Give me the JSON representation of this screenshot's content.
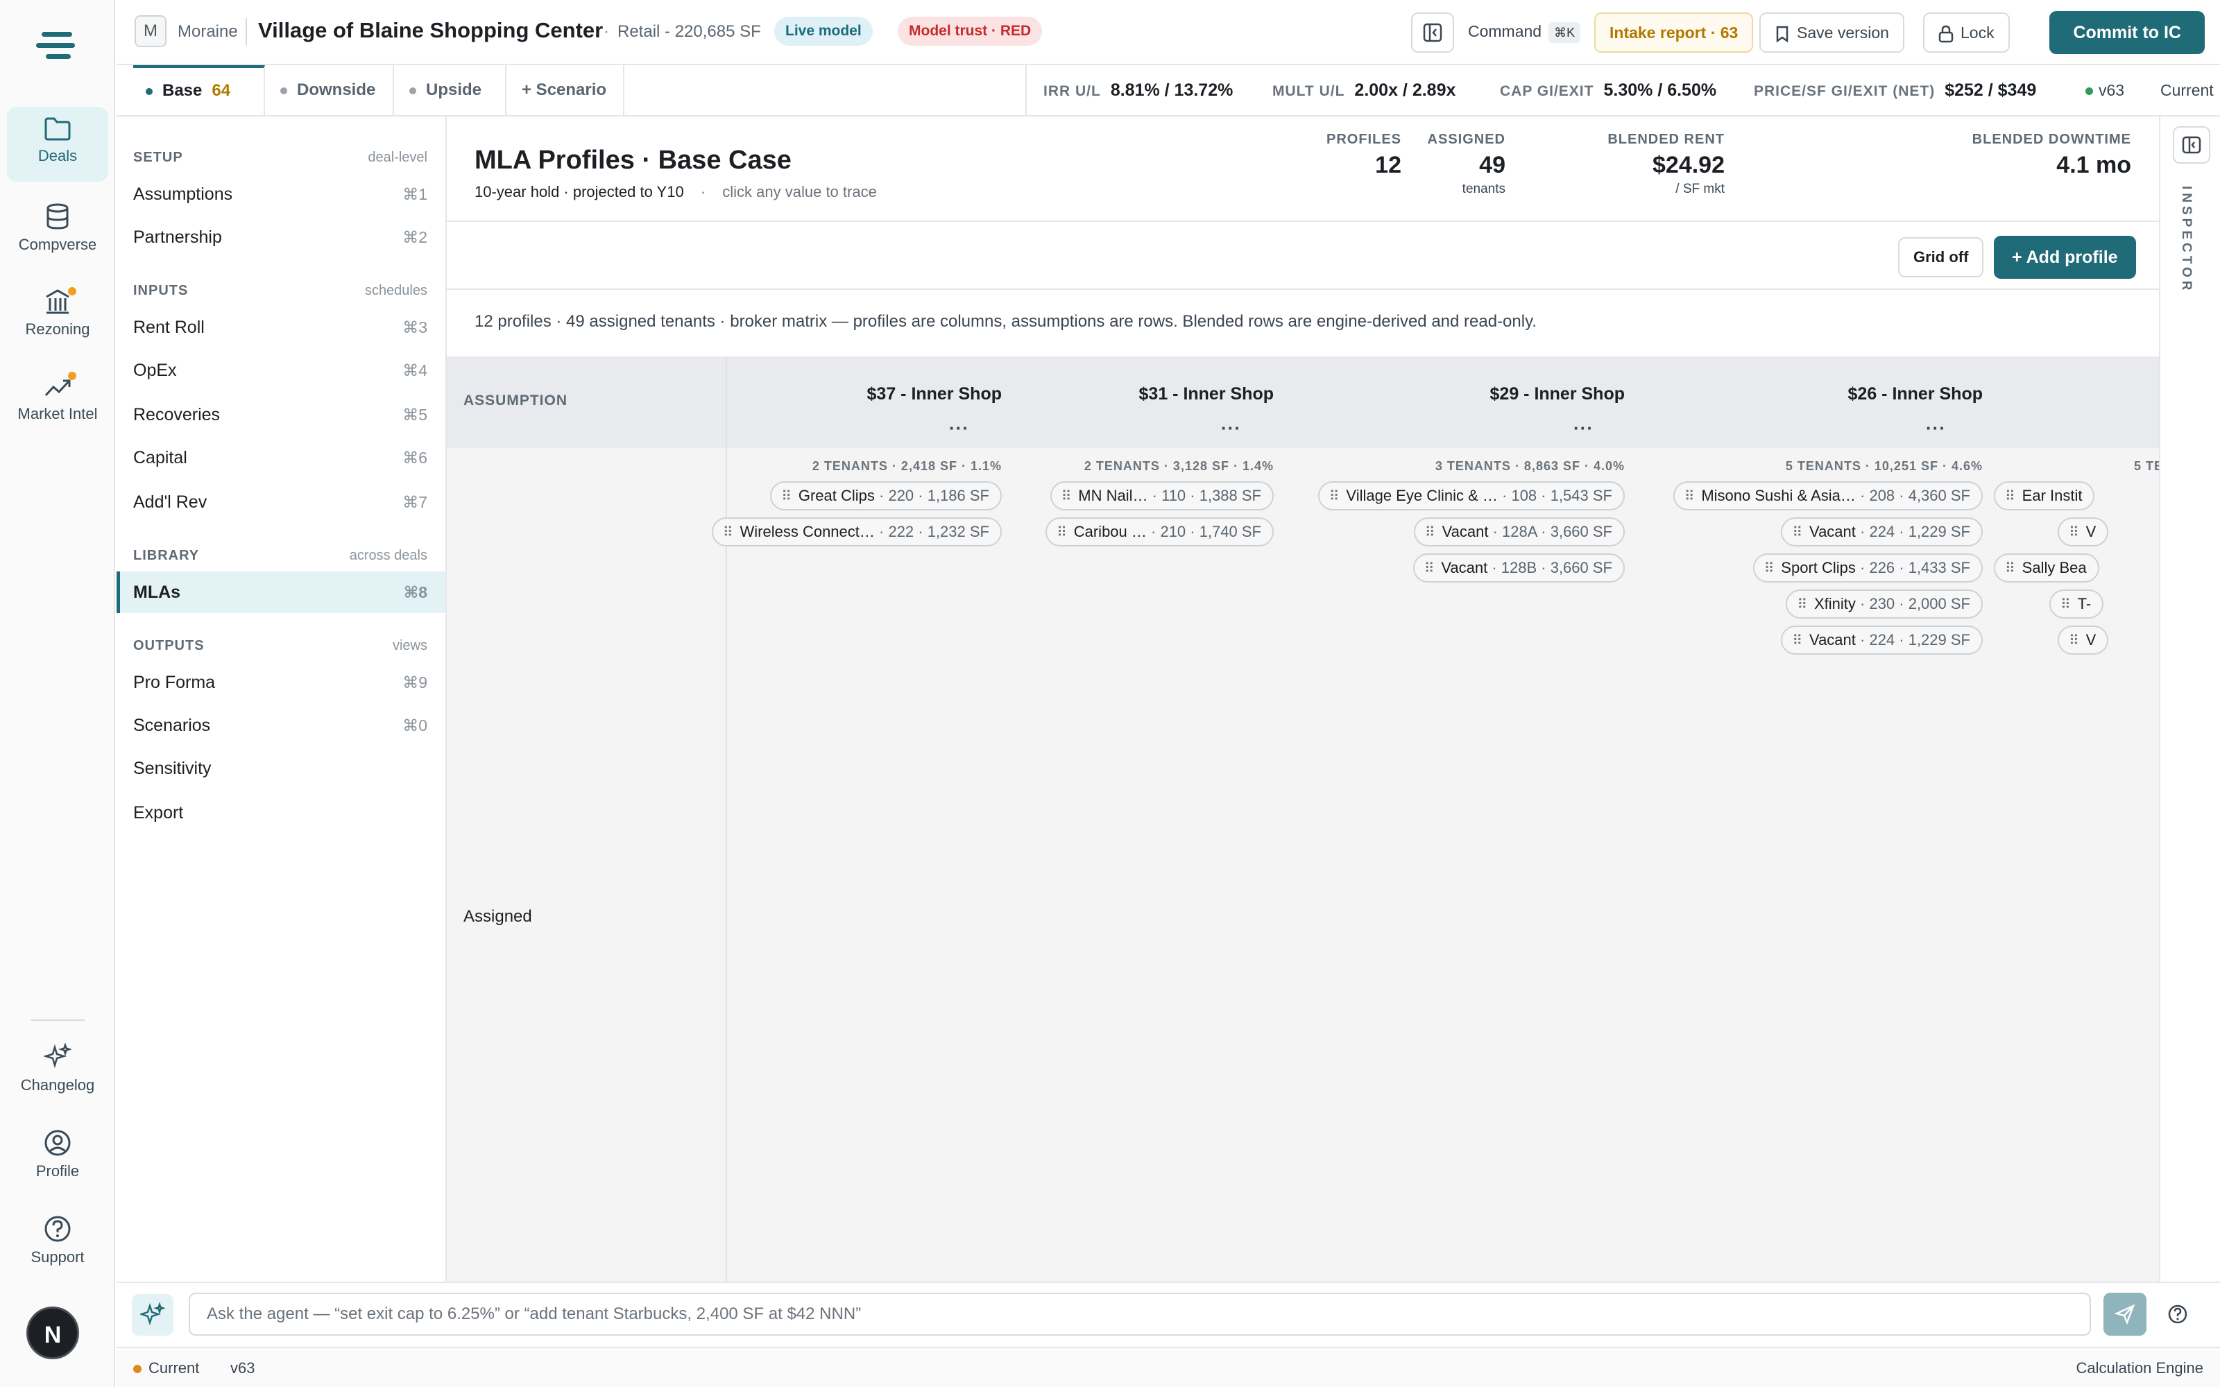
{
  "rail": {
    "items": [
      {
        "label": "Deals",
        "icon": "folder-icon",
        "active": true
      },
      {
        "label": "Compverse",
        "icon": "database-icon"
      },
      {
        "label": "Rezoning",
        "icon": "building-icon"
      },
      {
        "label": "Market Intel",
        "icon": "trend-icon"
      }
    ],
    "bottom": [
      {
        "label": "Changelog",
        "icon": "sparkle-icon"
      },
      {
        "label": "Profile",
        "icon": "user-circle-icon"
      },
      {
        "label": "Support",
        "icon": "help-circle-icon"
      }
    ],
    "avatar_letter": "N"
  },
  "topbar": {
    "org_initial": "M",
    "org_name": "Moraine",
    "deal_title": "Village of Blaine Shopping Center",
    "separator": "·",
    "deal_meta": "Retail - 220,685 SF",
    "live_badge": "Live model",
    "trust_badge": "Model trust · RED",
    "command_label": "Command",
    "command_kbd": "⌘K",
    "intake_label": "Intake report · 63",
    "save_label": "Save version",
    "lock_label": "Lock",
    "commit_label": "Commit to IC"
  },
  "scenarios": {
    "tabs": [
      {
        "label": "Base",
        "count": "64",
        "active": true
      },
      {
        "label": "Downside"
      },
      {
        "label": "Upside"
      }
    ],
    "add_label": "+ Scenario",
    "metrics": [
      {
        "label": "IRR U/L",
        "value": "8.81% / 13.72%"
      },
      {
        "label": "MULT U/L",
        "value": "2.00x / 2.89x"
      },
      {
        "label": "CAP GI/EXIT",
        "value": "5.30% / 6.50%"
      },
      {
        "label": "PRICE/SF GI/EXIT (NET)",
        "value": "$252 / $349"
      }
    ],
    "version": "v63",
    "version_state": "Current"
  },
  "nav": {
    "sections": [
      {
        "title": "SETUP",
        "sub": "deal-level",
        "items": [
          {
            "label": "Assumptions",
            "key": "⌘1"
          },
          {
            "label": "Partnership",
            "key": "⌘2"
          }
        ]
      },
      {
        "title": "INPUTS",
        "sub": "schedules",
        "items": [
          {
            "label": "Rent Roll",
            "key": "⌘3"
          },
          {
            "label": "OpEx",
            "key": "⌘4"
          },
          {
            "label": "Recoveries",
            "key": "⌘5"
          },
          {
            "label": "Capital",
            "key": "⌘6"
          },
          {
            "label": "Add'l Rev",
            "key": "⌘7"
          }
        ]
      },
      {
        "title": "LIBRARY",
        "sub": "across deals",
        "items": [
          {
            "label": "MLAs",
            "key": "⌘8",
            "active": true
          }
        ]
      },
      {
        "title": "OUTPUTS",
        "sub": "views",
        "items": [
          {
            "label": "Pro Forma",
            "key": "⌘9"
          },
          {
            "label": "Scenarios",
            "key": "⌘0"
          },
          {
            "label": "Sensitivity",
            "key": ""
          },
          {
            "label": "Export",
            "key": ""
          }
        ]
      }
    ]
  },
  "main": {
    "title": "MLA Profiles · Base Case",
    "subtitle": "10-year hold · projected to Y10",
    "subtitle_sep": "·",
    "subtitle_hint": "click any value to trace",
    "kpis": [
      {
        "label": "PROFILES",
        "value": "12",
        "unit": ""
      },
      {
        "label": "ASSIGNED",
        "value": "49",
        "unit": "tenants"
      },
      {
        "label": "BLENDED RENT",
        "value": "$24.92",
        "unit": "/ SF mkt"
      },
      {
        "label": "BLENDED DOWNTIME",
        "value": "4.1 mo",
        "unit": ""
      }
    ],
    "grid_button": "Grid off",
    "add_button": "+ Add profile",
    "description": "12 profiles · 49 assigned tenants · broker matrix — profiles are columns, assumptions are rows. Blended rows are engine-derived and read-only.",
    "assumption_header": "ASSUMPTION",
    "row_label": "Assigned",
    "more_glyph": "···",
    "grip_glyph": "⠿",
    "profiles": [
      {
        "name": "$37 - Inner Shop",
        "meta": "2 TENANTS · 2,418 SF · 1.1%",
        "tenants": [
          {
            "name": "Great Clips",
            "info": "· 220 · 1,186 SF"
          },
          {
            "name": "Wireless Connect…",
            "info": "· 222 · 1,232 SF"
          }
        ]
      },
      {
        "name": "$31 - Inner Shop",
        "meta": "2 TENANTS · 3,128 SF · 1.4%",
        "tenants": [
          {
            "name": "MN Nail…",
            "info": "· 110 · 1,388 SF"
          },
          {
            "name": "Caribou …",
            "info": "· 210 · 1,740 SF"
          }
        ]
      },
      {
        "name": "$29 - Inner Shop",
        "meta": "3 TENANTS · 8,863 SF · 4.0%",
        "tenants": [
          {
            "name": "Village Eye Clinic & …",
            "info": "· 108 · 1,543 SF"
          },
          {
            "name": "Vacant",
            "info": "· 128A · 3,660 SF"
          },
          {
            "name": "Vacant",
            "info": "· 128B · 3,660 SF"
          }
        ]
      },
      {
        "name": "$26 - Inner Shop",
        "meta": "5 TENANTS · 10,251 SF · 4.6%",
        "tenants": [
          {
            "name": "Misono Sushi & Asia…",
            "info": "· 208 · 4,360 SF"
          },
          {
            "name": "Vacant",
            "info": "· 224 · 1,229 SF"
          },
          {
            "name": "Sport Clips",
            "info": "· 226 · 1,433 SF"
          },
          {
            "name": "Xfinity",
            "info": "· 230 · 2,000 SF"
          },
          {
            "name": "Vacant",
            "info": "· 224 · 1,229 SF"
          }
        ]
      }
    ],
    "clipped_column": {
      "meta": "5 TE",
      "tenants": [
        "Ear Instit",
        "V",
        "Sally Bea",
        "T-",
        "V"
      ]
    }
  },
  "inspector_label": "INSPECTOR",
  "agent": {
    "placeholder": "Ask the agent — “set exit cap to 6.25%” or “add tenant Starbucks, 2,400 SF at $42 NNN”"
  },
  "status": {
    "state": "Current",
    "version": "v63",
    "engine": "Calculation Engine"
  },
  "colors": {
    "accent": "#1f6b78",
    "active_bg": "#e3f2f4",
    "danger": "#c82a2a",
    "warning": "#b07a00"
  }
}
